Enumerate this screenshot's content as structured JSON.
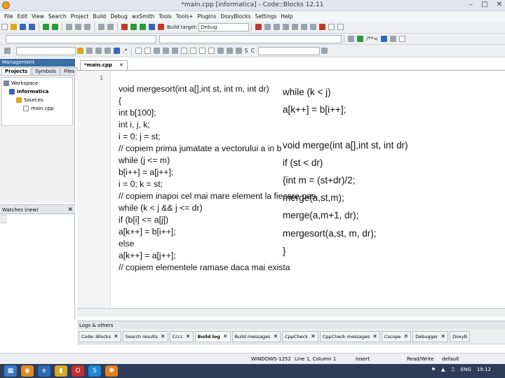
{
  "window": {
    "title": "*main.cpp [informatica] - Code::Blocks 12.11"
  },
  "menu": [
    "File",
    "Edit",
    "View",
    "Search",
    "Project",
    "Build",
    "Debug",
    "wxSmith",
    "Tools",
    "Tools+",
    "Plugins",
    "DoxyBlocks",
    "Settings",
    "Help"
  ],
  "toolbar": {
    "build_target_label": "Build target:",
    "build_target_value": "Debug"
  },
  "management": {
    "title": "Management",
    "tabs": [
      "Projects",
      "Symbols",
      "Files"
    ],
    "tree": [
      "Workspace",
      "informatica",
      "Sources",
      "main.cpp"
    ]
  },
  "watches": {
    "title": "Watches (new)"
  },
  "editor": {
    "tab_label": "*main.cpp",
    "line_number": "1",
    "code_left": "void mergesort(int a[],int st, int m, int dr)\n{\nint b[100];\nint i, j, k;\ni = 0; j = st;\n// copiem prima jumatate a vectorului a in b\nwhile (j <= m)\nb[i++] = a[j++];\ni = 0; k = st;\n// copiem inapoi cel mai mare element la fiecare pas\nwhile (k < j && j <= dr)\nif (b[i] <= a[j])\na[k++] = b[i++];\nelse\na[k++] = a[j++];\n// copiem elementele ramase daca mai exista",
    "code_right": "while (k < j)\na[k++] = b[i++];\n\nvoid merge(int a[],int st, int dr)\nif (st < dr)\n{int m = (st+dr)/2;\nmerge(a,st,m);\nmerge(a,m+1, dr);\nmergesort(a,st, m, dr);\n}"
  },
  "logs": {
    "title": "Logs & others",
    "tabs": [
      "Code::Blocks",
      "Search results",
      "Cccc",
      "Build log",
      "Build messages",
      "CppCheck",
      "CppCheck messages",
      "Cscope",
      "Debugger",
      "DoxyB"
    ]
  },
  "status": {
    "encoding": "WINDOWS-1252",
    "position": "Line 1, Column 1",
    "mode": "Insert",
    "access": "Read/Write",
    "profile": "default"
  },
  "taskbar": {
    "language": "ENG",
    "time": "19:12"
  }
}
